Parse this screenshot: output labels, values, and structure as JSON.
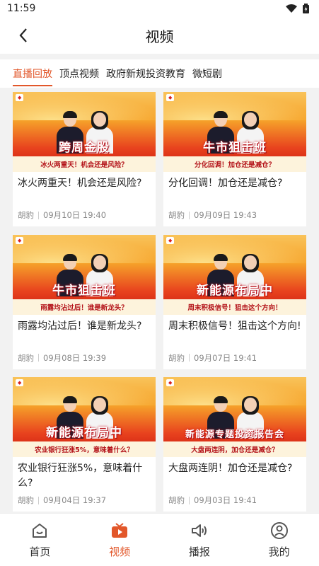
{
  "status": {
    "time": "11:59"
  },
  "header": {
    "title": "视频"
  },
  "tabs": [
    {
      "label": "直播回放",
      "active": true
    },
    {
      "label": "顶点视频",
      "active": false
    },
    {
      "label": "政府新规投资教育",
      "active": false
    },
    {
      "label": "微短剧",
      "active": false
    }
  ],
  "cards": [
    {
      "banner_title": "跨周金股",
      "banner_sub": "冰火两重天！机会还是风险？",
      "title": "冰火两重天！机会还是风险?",
      "author": "胡豹",
      "date": "09月10日 19:40"
    },
    {
      "banner_title": "牛市狙击班",
      "banner_sub": "分化回调！加仓还是减仓？",
      "title": "分化回调！加仓还是减仓?",
      "author": "胡豹",
      "date": "09月09日 19:43"
    },
    {
      "banner_title": "牛市狙击班",
      "banner_sub": "雨露均沾过后！谁是新龙头？",
      "title": "雨露均沾过后！谁是新龙头?",
      "author": "胡豹",
      "date": "09月08日 19:39"
    },
    {
      "banner_title": "新能源布局中",
      "banner_sub": "周末积极信号！狙击这个方向！",
      "title": "周末积极信号！狙击这个方向!",
      "author": "胡豹",
      "date": "09月07日 19:41"
    },
    {
      "banner_title": "新能源布局中",
      "banner_sub": "农业银行狂涨5%，意味着什么？",
      "title": "农业银行狂涨5%，意味着什么?",
      "author": "胡豹",
      "date": "09月04日 19:37"
    },
    {
      "banner_title": "新能源专题投资报告会",
      "banner_sub": "大盘两连阴，加仓还是减仓？",
      "title": "大盘两连阴！加仓还是减仓?",
      "author": "胡豹",
      "date": "09月03日 19:41"
    }
  ],
  "bottom_nav": [
    {
      "label": "首页",
      "icon": "home-icon",
      "active": false
    },
    {
      "label": "视频",
      "icon": "video-icon",
      "active": true
    },
    {
      "label": "播报",
      "icon": "speaker-icon",
      "active": false
    },
    {
      "label": "我的",
      "icon": "user-icon",
      "active": false
    }
  ],
  "colors": {
    "accent": "#e2572a"
  }
}
